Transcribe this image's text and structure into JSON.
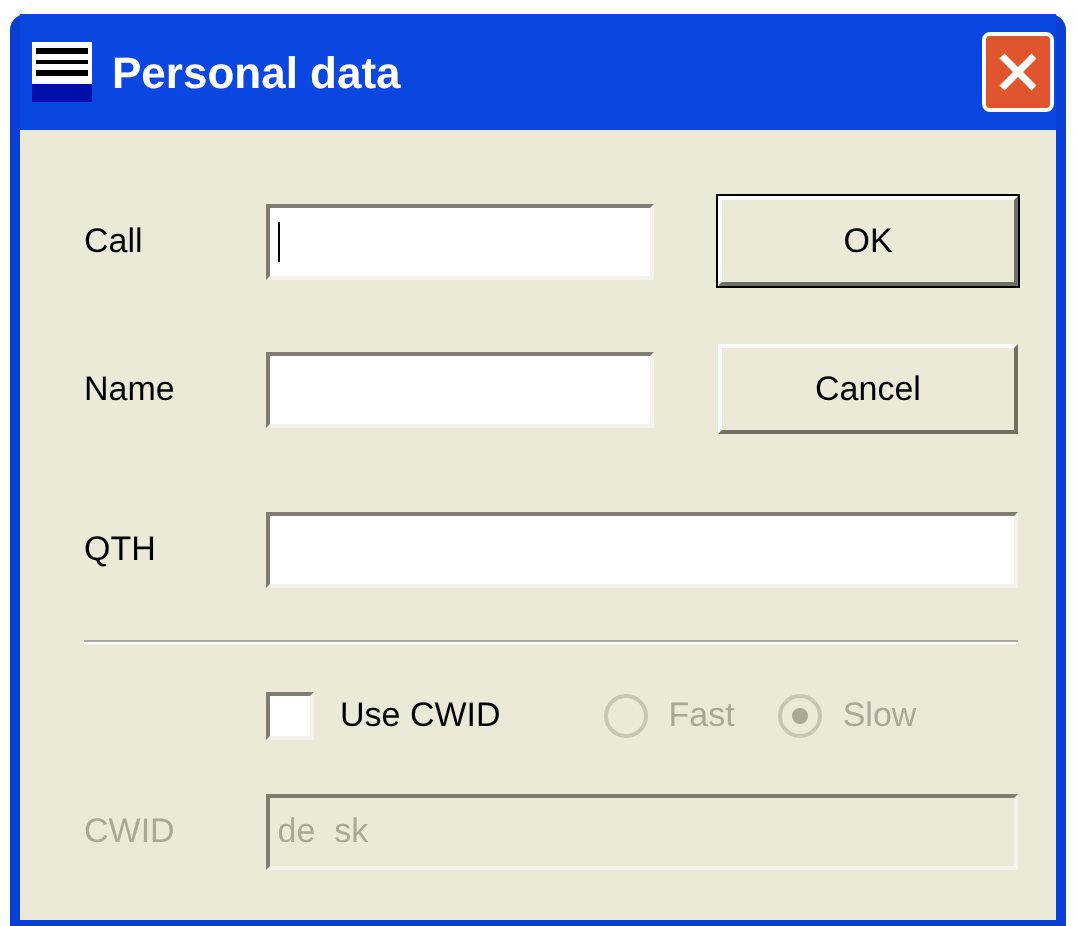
{
  "window": {
    "title": "Personal data"
  },
  "fields": [
    {
      "label": "Call",
      "focused": true,
      "disabled": false
    },
    {
      "label": "Name",
      "focused": false,
      "disabled": false
    },
    {
      "label": "QTH",
      "focused": false,
      "disabled": false
    }
  ],
  "buttons": [
    {
      "label": "OK",
      "default": true
    },
    {
      "label": "Cancel",
      "default": false
    }
  ],
  "use_cwid": {
    "label": "Use CWID",
    "checked": false
  },
  "speed": [
    {
      "label": "Fast",
      "selected": false,
      "disabled": true
    },
    {
      "label": "Slow",
      "selected": true,
      "disabled": true
    }
  ],
  "cwid": {
    "label": "CWID",
    "value": "de  sk",
    "disabled": true
  }
}
